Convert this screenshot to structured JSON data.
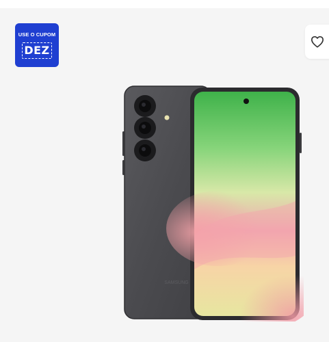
{
  "coupon": {
    "line1": "USE O CUPOM",
    "code": "DEZ",
    "color": "#1f3fd1"
  },
  "favorite": {
    "icon": "heart-icon"
  },
  "product_image": {
    "brand_mark": "SAMSUNG",
    "body_color": "#4a4a4d"
  }
}
